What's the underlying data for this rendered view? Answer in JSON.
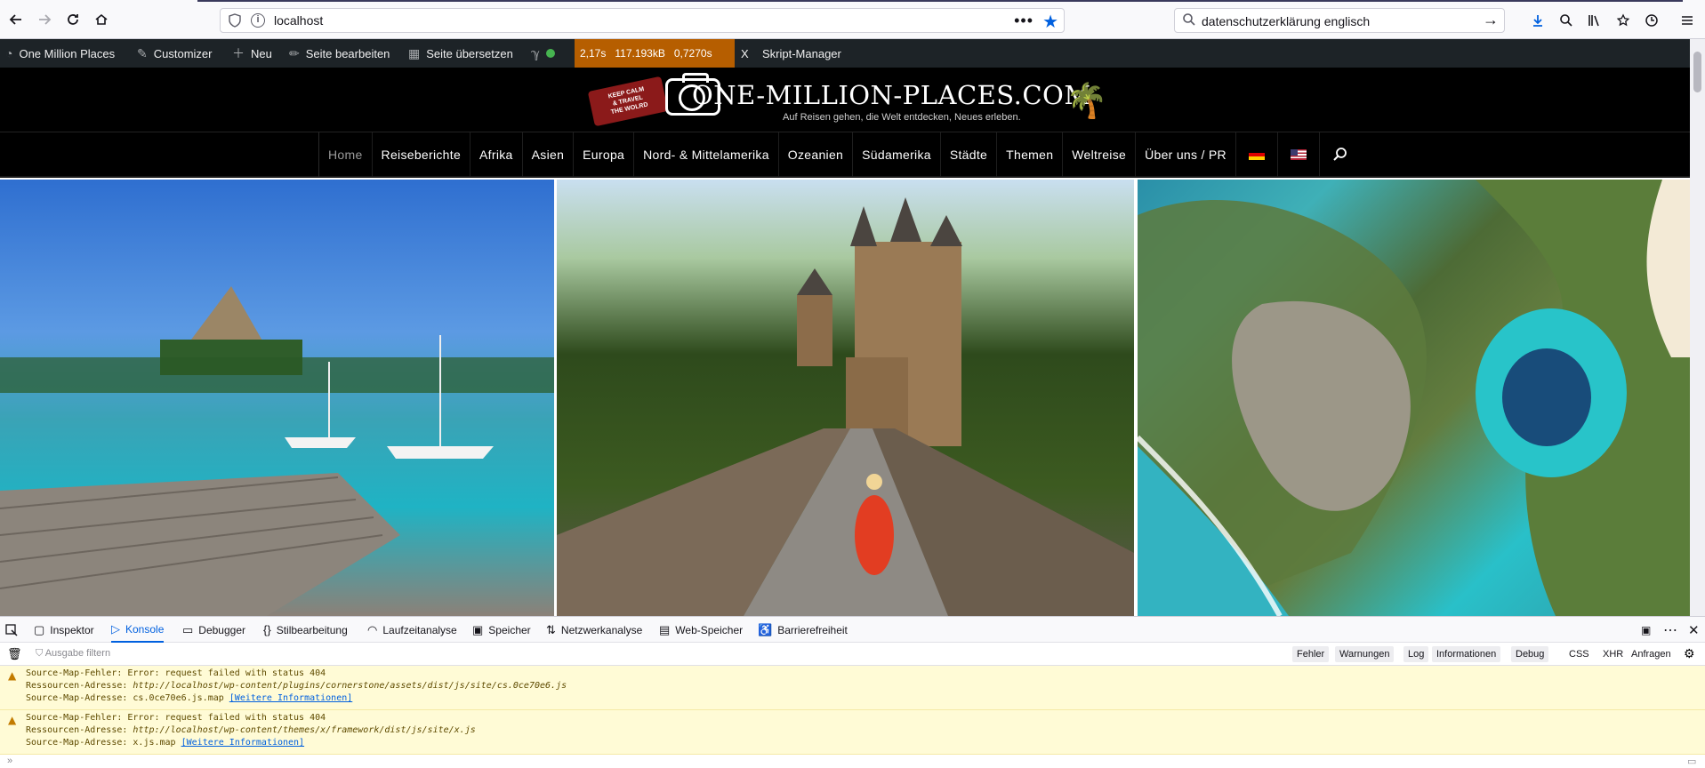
{
  "browser": {
    "url": "localhost",
    "search_text": "datenschutzerklärung englisch",
    "more_glyph": "•••"
  },
  "adminbar": {
    "site_name": "One Million Places",
    "customizer": "Customizer",
    "new": "Neu",
    "edit_page": "Seite bearbeiten",
    "translate_page": "Seite übersetzen",
    "perf_time": "2,17s",
    "perf_memory": "117.193kB",
    "perf_query": "0,7270s",
    "perf_close": "X",
    "script_manager": "Skript-Manager"
  },
  "site": {
    "logo_tag": "KEEP CALM & TRAVEL THE WOLRD",
    "title": "ONE-MILLION-PLACES.COM",
    "subtitle": "Auf Reisen gehen, die Welt entdecken, Neues erleben.",
    "nav": [
      "Home",
      "Reiseberichte",
      "Afrika",
      "Asien",
      "Europa",
      "Nord- & Mittelamerika",
      "Ozeanien",
      "Südamerika",
      "Städte",
      "Themen",
      "Weltreise",
      "Über uns / PR"
    ]
  },
  "devtools": {
    "tabs": [
      "Inspektor",
      "Konsole",
      "Debugger",
      "Stilbearbeitung",
      "Laufzeitanalyse",
      "Speicher",
      "Netzwerkanalyse",
      "Web-Speicher",
      "Barrierefreiheit"
    ],
    "filter_placeholder": "Ausgabe filtern",
    "filters": [
      "Fehler",
      "Warnungen",
      "Log",
      "Informationen",
      "Debug"
    ],
    "filters_plain": [
      "CSS",
      "XHR",
      "Anfragen"
    ],
    "messages": [
      {
        "line1": "Source-Map-Fehler: Error: request failed with status 404",
        "resource_label": "Ressourcen-Adresse: ",
        "resource_url": "http://localhost/wp-content/plugins/cornerstone/assets/dist/js/site/cs.0ce70e6.js",
        "map_label": "Source-Map-Adresse: cs.0ce70e6.js.map ",
        "more_info": "[Weitere Informationen]"
      },
      {
        "line1": "Source-Map-Fehler: Error: request failed with status 404",
        "resource_label": "Ressourcen-Adresse: ",
        "resource_url": "http://localhost/wp-content/themes/x/framework/dist/js/site/x.js",
        "map_label": "Source-Map-Adresse: x.js.map ",
        "more_info": "[Weitere Informationen]"
      }
    ],
    "prompt": "»"
  }
}
